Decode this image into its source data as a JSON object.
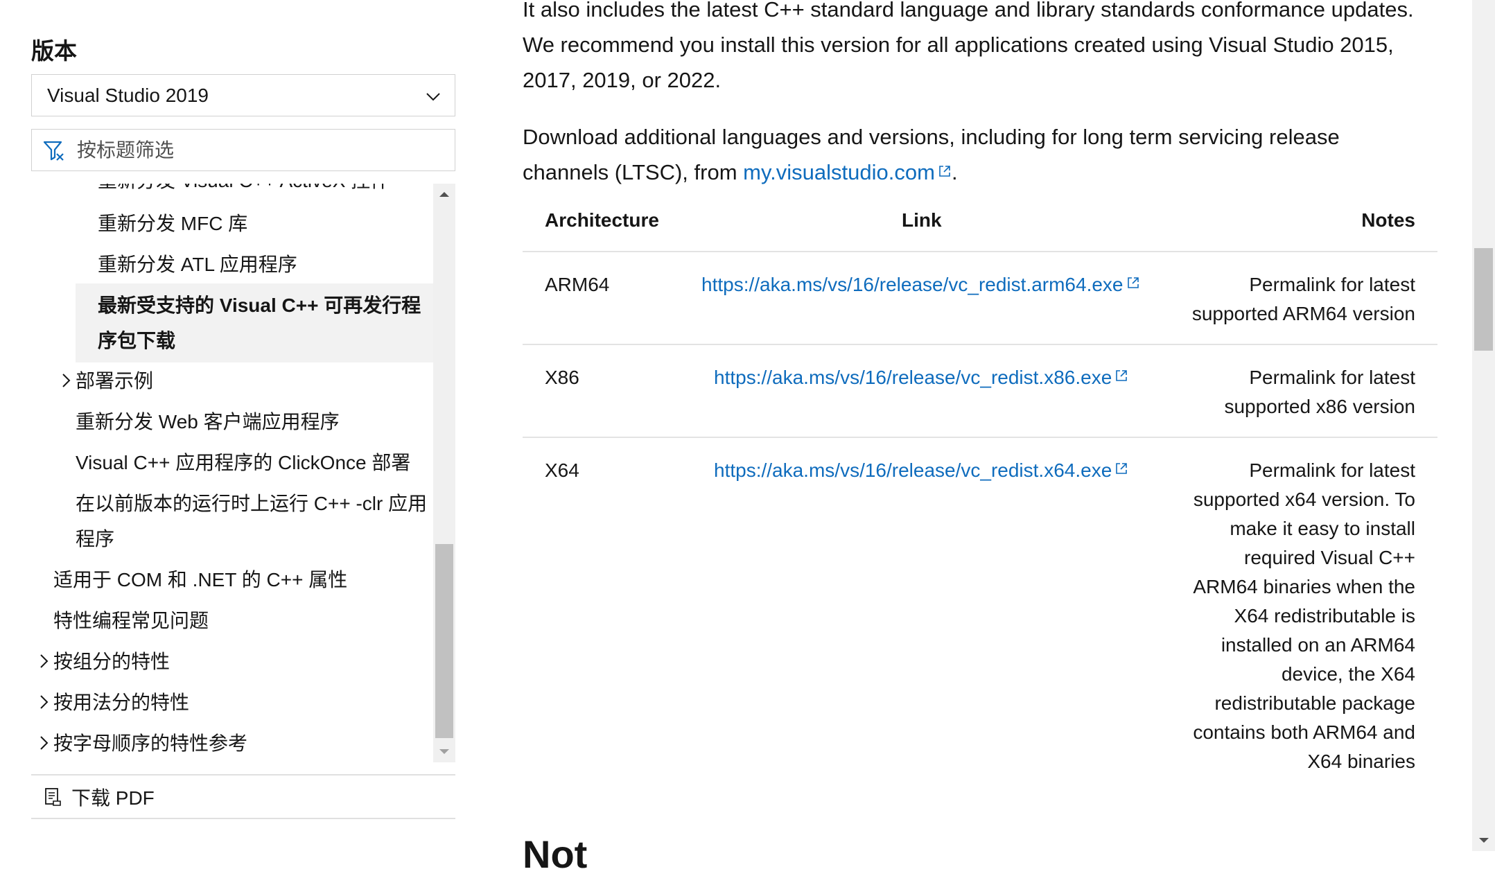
{
  "sidebar": {
    "version_heading": "版本",
    "version_select": {
      "value": "Visual Studio 2019"
    },
    "filter": {
      "placeholder": "按标题筛选"
    },
    "toc": {
      "items": [
        {
          "label": "重新分发 Visual C++ ActiveX 控件"
        },
        {
          "label": "重新分发 MFC 库"
        },
        {
          "label": "重新分发 ATL 应用程序"
        },
        {
          "label": "最新受支持的 Visual C++ 可再发行程序包下载",
          "active": true
        },
        {
          "label": "部署示例"
        },
        {
          "label": "重新分发 Web 客户端应用程序"
        },
        {
          "label": "Visual C++ 应用程序的 ClickOnce 部署"
        },
        {
          "label": "在以前版本的运行时上运行 C++ -clr 应用程序"
        },
        {
          "label": "适用于 COM 和 .NET 的 C++ 属性"
        },
        {
          "label": "特性编程常见问题"
        },
        {
          "label": "按组分的特性"
        },
        {
          "label": "按用法分的特性"
        },
        {
          "label": "按字母顺序的特性参考"
        }
      ]
    },
    "download_pdf": "下载 PDF"
  },
  "main": {
    "para1": "It also includes the latest C++ standard language and library standards conformance updates. We recommend you install this version for all applications created using Visual Studio 2015, 2017, 2019, or 2022.",
    "para2_text": "Download additional languages and versions, including for long term servicing release channels (LTSC), from ",
    "para2_link": "my.visualstudio.com",
    "para2_end": ".",
    "table": {
      "headers": {
        "architecture": "Architecture",
        "link": "Link",
        "notes": "Notes"
      },
      "rows": [
        {
          "architecture": "ARM64",
          "link": "https://aka.ms/vs/16/release/vc_redist.arm64.exe",
          "notes": "Permalink for latest supported ARM64 version"
        },
        {
          "architecture": "X86",
          "link": "https://aka.ms/vs/16/release/vc_redist.x86.exe",
          "notes": "Permalink for latest supported x86 version"
        },
        {
          "architecture": "X64",
          "link": "https://aka.ms/vs/16/release/vc_redist.x64.exe",
          "notes": "Permalink for latest supported x64 version. To make it easy to install required Visual C++ ARM64 binaries when the X64 redistributable is installed on an ARM64 device, the X64 redistributable package contains both ARM64 and X64 binaries"
        }
      ]
    },
    "next_heading": "Not"
  },
  "colors": {
    "link": "#0f6cbd",
    "text": "#161616",
    "active_bg": "#f2f2f2"
  }
}
